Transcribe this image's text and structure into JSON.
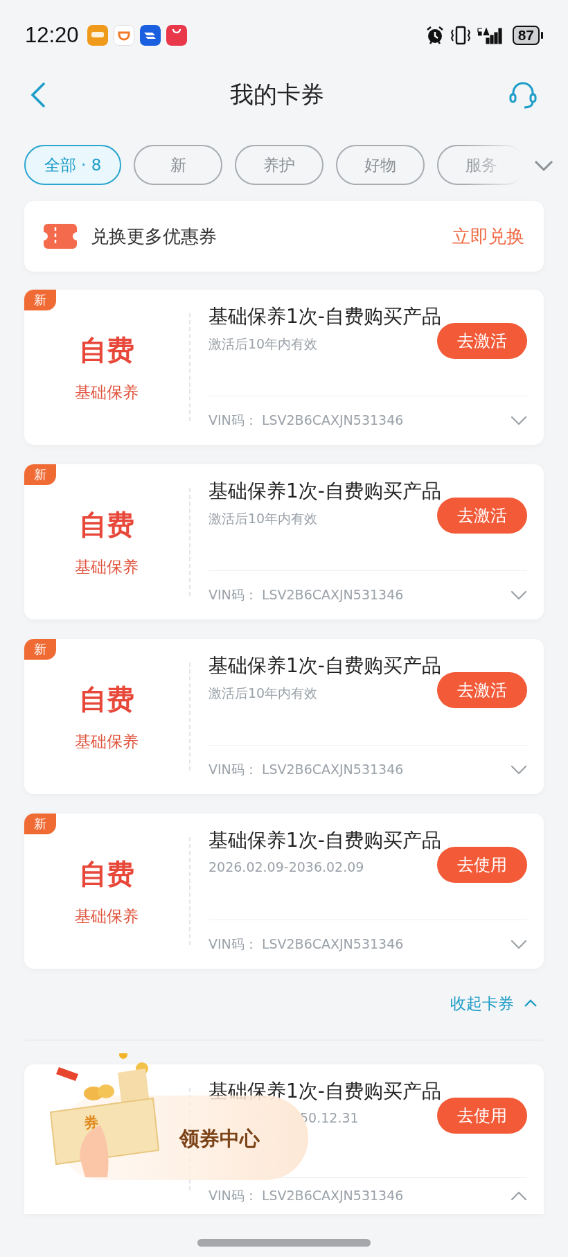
{
  "status_bar": {
    "time": "12:20",
    "battery": "87"
  },
  "header": {
    "title": "我的卡券"
  },
  "tabs": [
    {
      "label": "全部 · 8",
      "selected": true
    },
    {
      "label": "新",
      "selected": false
    },
    {
      "label": "养护",
      "selected": false
    },
    {
      "label": "好物",
      "selected": false
    },
    {
      "label": "服务",
      "selected": false
    }
  ],
  "exchange": {
    "label": "兑换更多优惠券",
    "action": "立即兑换"
  },
  "coupons": [
    {
      "new_badge": "新",
      "stamp": "自费",
      "stamp_sub": "基础保养",
      "title": "基础保养1次-自费购买产品",
      "validity": "激活后10年内有效",
      "button": "去激活",
      "vin_label": "VIN码：",
      "vin": "LSV2B6CAXJN531346",
      "expanded": false
    },
    {
      "new_badge": "新",
      "stamp": "自费",
      "stamp_sub": "基础保养",
      "title": "基础保养1次-自费购买产品",
      "validity": "激活后10年内有效",
      "button": "去激活",
      "vin_label": "VIN码：",
      "vin": "LSV2B6CAXJN531346",
      "expanded": false
    },
    {
      "new_badge": "新",
      "stamp": "自费",
      "stamp_sub": "基础保养",
      "title": "基础保养1次-自费购买产品",
      "validity": "激活后10年内有效",
      "button": "去激活",
      "vin_label": "VIN码：",
      "vin": "LSV2B6CAXJN531346",
      "expanded": false
    },
    {
      "new_badge": "新",
      "stamp": "自费",
      "stamp_sub": "基础保养",
      "title": "基础保养1次-自费购买产品",
      "validity": "2026.02.09-2036.02.09",
      "button": "去使用",
      "vin_label": "VIN码：",
      "vin": "LSV2B6CAXJN531346",
      "expanded": false
    }
  ],
  "collapse_link": "收起卡券",
  "covered_coupon": {
    "title": "基础保养1次-自费购买产品",
    "validity": "50.12.31",
    "button": "去使用",
    "vin_label": "VIN码：",
    "vin": "LSV2B6CAXJN531346",
    "expanded": true
  },
  "floating_banner": {
    "ticket_label": "券",
    "label": "领券中心"
  }
}
